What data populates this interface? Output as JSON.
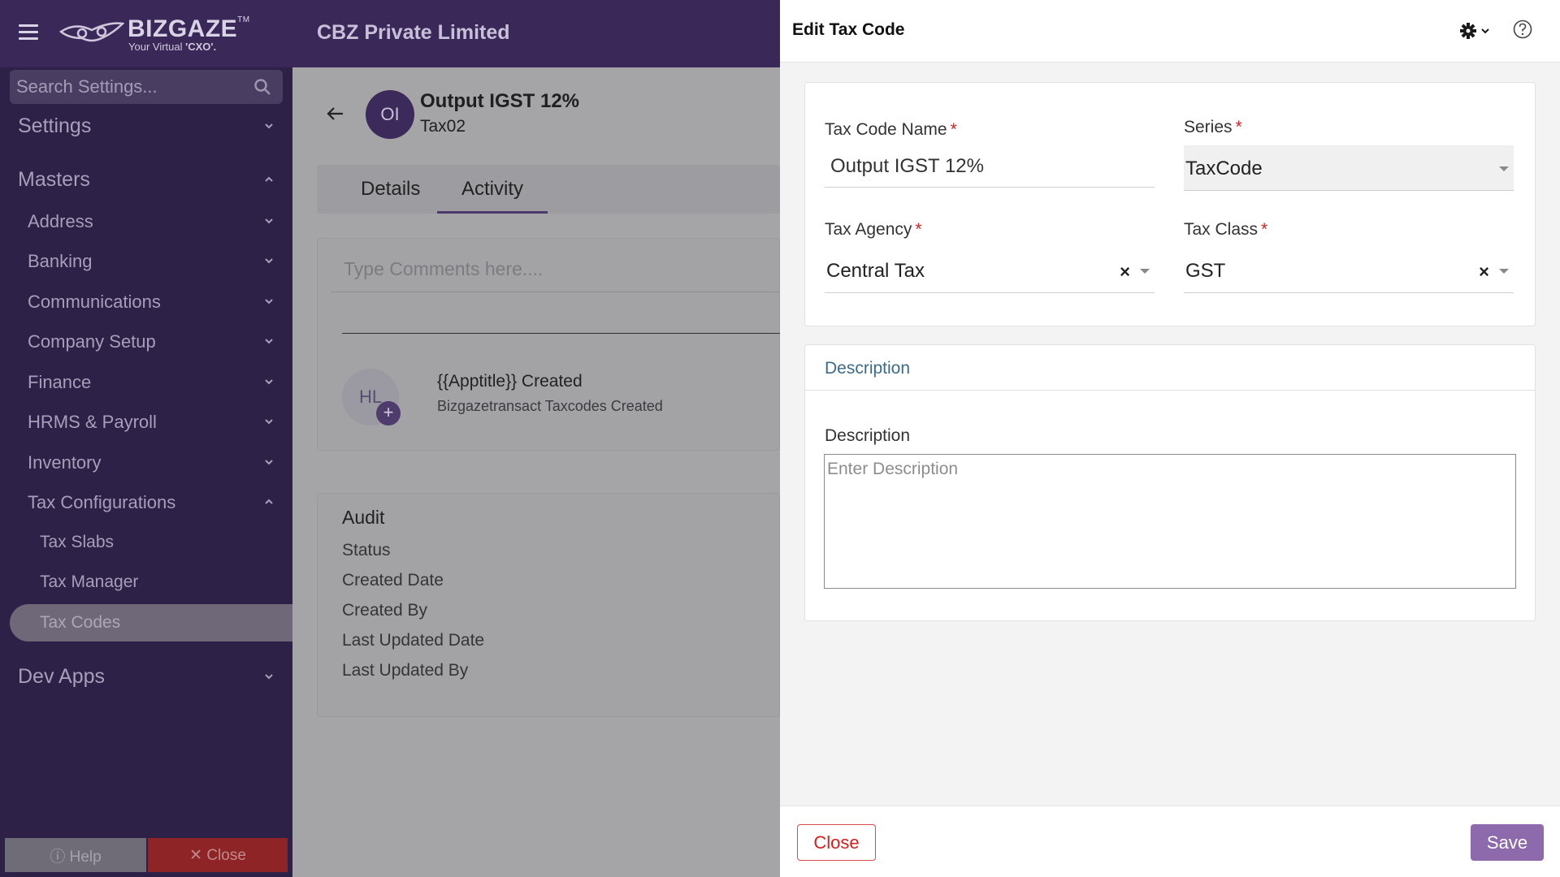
{
  "app": {
    "logo_word": "BIZGAZE",
    "logo_tagline_prefix": "Your Virtual",
    "logo_tagline_emph": "'CXO'.",
    "logo_tm": "TM",
    "company": "CBZ Private Limited"
  },
  "sidebar": {
    "search_placeholder": "Search Settings...",
    "sections": {
      "settings": "Settings",
      "masters": "Masters",
      "dev_apps": "Dev Apps"
    },
    "masters_items": [
      "Address",
      "Banking",
      "Communications",
      "Company Setup",
      "Finance",
      "HRMS & Payroll",
      "Inventory",
      "Tax Configurations"
    ],
    "tax_items": [
      "Tax Slabs",
      "Tax Manager",
      "Tax Codes"
    ],
    "active_item": "Tax Codes",
    "help_label": "Help",
    "close_label": "Close"
  },
  "record": {
    "initials": "OI",
    "title": "Output IGST 12%",
    "code": "Tax02",
    "tabs": [
      "Details",
      "Activity"
    ],
    "active_tab": "Activity"
  },
  "activity": {
    "comment_placeholder": "Type Comments here....",
    "entry_initials": "HL",
    "entry_plus": "+",
    "entry_title": "{{Apptitle}} Created",
    "entry_sub": "Bizgazetransact Taxcodes Created"
  },
  "audit": {
    "title": "Audit",
    "rows": [
      "Status",
      "Created Date",
      "Created By",
      "Last Updated Date",
      "Last Updated By"
    ]
  },
  "drawer": {
    "title": "Edit Tax Code",
    "fields": {
      "tax_code_name_label": "Tax Code Name",
      "tax_code_name_value": "Output IGST 12%",
      "series_label": "Series",
      "series_value": "TaxCode",
      "tax_agency_label": "Tax Agency",
      "tax_agency_value": "Central Tax",
      "tax_class_label": "Tax Class",
      "tax_class_value": "GST",
      "required_mark": "*",
      "clear_mark": "×"
    },
    "description": {
      "section_title": "Description",
      "label": "Description",
      "placeholder": "Enter Description"
    },
    "footer": {
      "close_label": "Close",
      "save_label": "Save"
    }
  },
  "colors": {
    "header_bg": "#3a2859",
    "sidebar_bg": "#2e2147",
    "accent": "#8d6aab",
    "danger": "#d32020",
    "description_title": "#3d6a8a"
  }
}
